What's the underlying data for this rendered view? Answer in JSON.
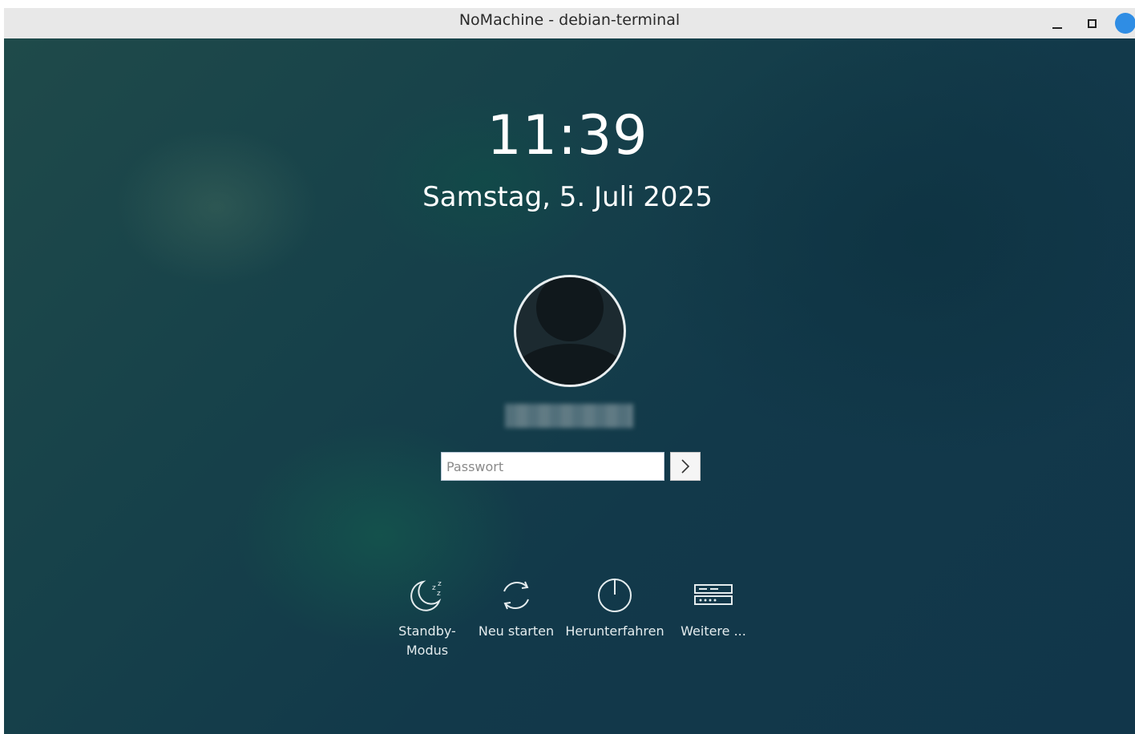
{
  "window": {
    "title": "NoMachine - debian-terminal"
  },
  "lockscreen": {
    "time": "11:39",
    "date": "Samstag, 5. Juli 2025",
    "username": "",
    "password_placeholder": "Passwort",
    "actions": [
      {
        "label": "Standby-\nModus",
        "icon": "standby-icon"
      },
      {
        "label": "Neu starten",
        "icon": "restart-icon"
      },
      {
        "label": "Herunterfahren",
        "icon": "power-icon"
      },
      {
        "label": "Weitere ...",
        "icon": "more-options-icon"
      }
    ]
  },
  "colors": {
    "background": "#17424a",
    "titlebar": "#e8e8e8",
    "close_button": "#2f8de4",
    "text": "#ffffff"
  }
}
